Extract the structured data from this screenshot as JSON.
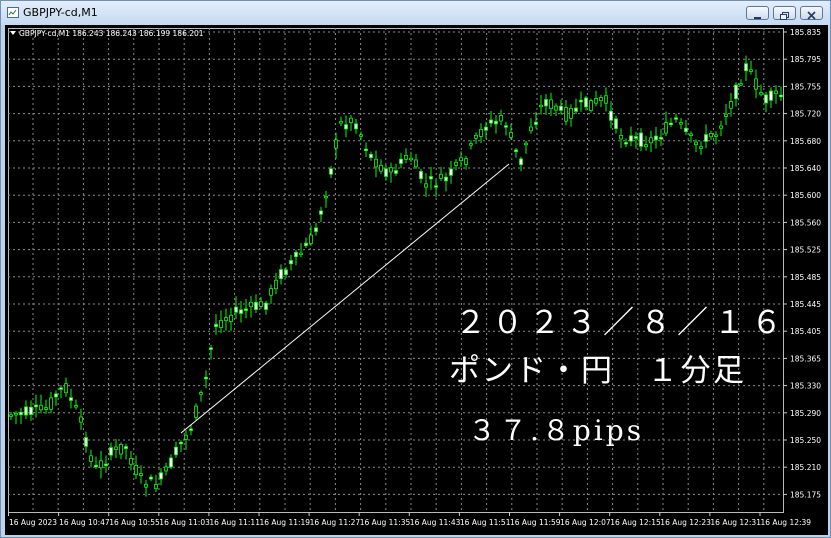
{
  "window": {
    "title": "GBPJPY-cd,M1"
  },
  "chart": {
    "header_text": "GBPJPY-cd,M1  186.243 186.243 186.199 186.201",
    "y_labels": [
      "185.835",
      "185.795",
      "185.755",
      "185.720",
      "185.680",
      "185.640",
      "185.600",
      "185.560",
      "185.525",
      "185.485",
      "185.445",
      "185.405",
      "185.365",
      "185.330",
      "185.290",
      "185.250",
      "185.210",
      "185.175"
    ],
    "x_labels": [
      "16 Aug 2023",
      "16 Aug 10:47",
      "16 Aug 10:55",
      "16 Aug 11:03",
      "16 Aug 11:11",
      "16 Aug 11:19",
      "16 Aug 11:27",
      "16 Aug 11:35",
      "16 Aug 11:43",
      "16 Aug 11:51",
      "16 Aug 11:59",
      "16 Aug 12:07",
      "16 Aug 12:15",
      "16 Aug 12:23",
      "16 Aug 12:31",
      "16 Aug 12:39"
    ],
    "overlay": {
      "line1": "２０２３／８／１６",
      "line2": "ポンド・円　１分足",
      "line3": "３７.８pips"
    },
    "colors": {
      "background": "#000000",
      "candles": "#00ff00",
      "bull_body": "#ffffff",
      "grid": "#8a8a8a",
      "trend_line": "#ffffff"
    }
  }
}
